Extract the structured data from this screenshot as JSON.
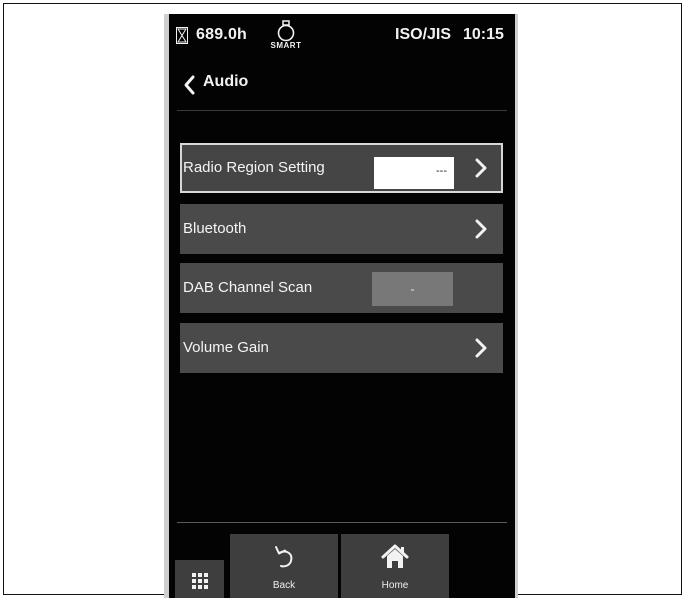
{
  "status_bar": {
    "hours": "689.0h",
    "smart_label": "SMART",
    "standard": "ISO/JIS",
    "time": "10:15"
  },
  "header": {
    "title": "Audio"
  },
  "settings": {
    "radio_region": {
      "label": "Radio Region Setting",
      "value": "---"
    },
    "bluetooth": {
      "label": "Bluetooth"
    },
    "dab_scan": {
      "label": "DAB Channel Scan",
      "value": "-"
    },
    "volume_gain": {
      "label": "Volume Gain"
    }
  },
  "bottom_nav": {
    "back_label": "Back",
    "home_label": "Home"
  },
  "icons": {
    "hourglass": "hourglass-icon",
    "smart_key": "smart-key-icon",
    "back_chevron": "chevron-left-icon",
    "row_chevron": "chevron-right-icon",
    "back": "undo-arrow-icon",
    "home": "home-icon",
    "apps": "grid-icon"
  }
}
